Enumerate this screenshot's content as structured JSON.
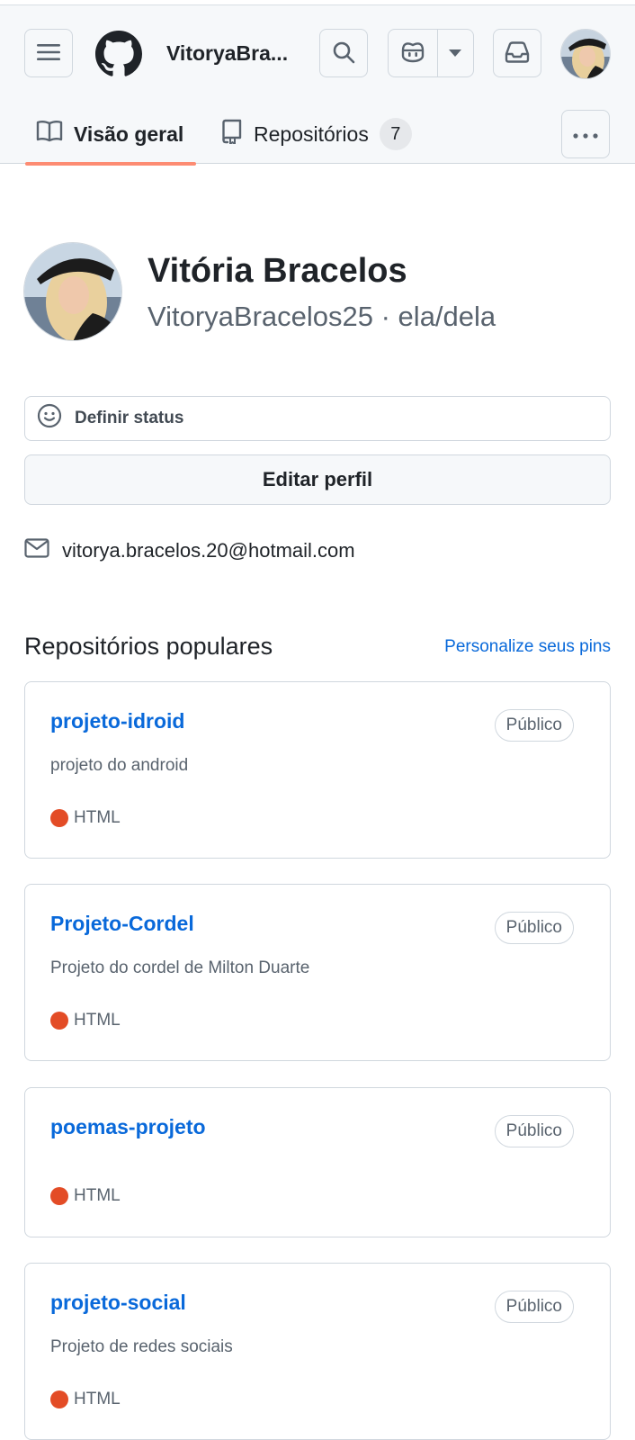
{
  "header": {
    "username": "VitoryaBra...",
    "tabs": [
      {
        "label": "Visão geral",
        "icon": "book-icon"
      },
      {
        "label": "Repositórios",
        "icon": "repo-icon",
        "count": "7"
      }
    ]
  },
  "profile": {
    "full_name": "Vitória Bracelos",
    "login_line": "VitoryaBracelos25 · ela/dela",
    "status_label": "Definir status",
    "edit_label": "Editar perfil",
    "email": "vitorya.bracelos.20@hotmail.com"
  },
  "popular": {
    "title": "Repositórios populares",
    "customize_label": "Personalize seus pins",
    "repos": [
      {
        "name": "projeto-idroid",
        "visibility": "Público",
        "description": "projeto do android",
        "language": "HTML",
        "language_color": "#e34c26"
      },
      {
        "name": "Projeto-Cordel",
        "visibility": "Público",
        "description": "Projeto do cordel de Milton Duarte",
        "language": "HTML",
        "language_color": "#e34c26"
      },
      {
        "name": "poemas-projeto",
        "visibility": "Público",
        "description": "",
        "language": "HTML",
        "language_color": "#e34c26"
      },
      {
        "name": "projeto-social",
        "visibility": "Público",
        "description": "Projeto de redes sociais",
        "language": "HTML",
        "language_color": "#e34c26"
      }
    ]
  },
  "colors": {
    "accent_link": "#0969da",
    "tab_underline": "#fd8c73",
    "html_language": "#e34c26"
  }
}
